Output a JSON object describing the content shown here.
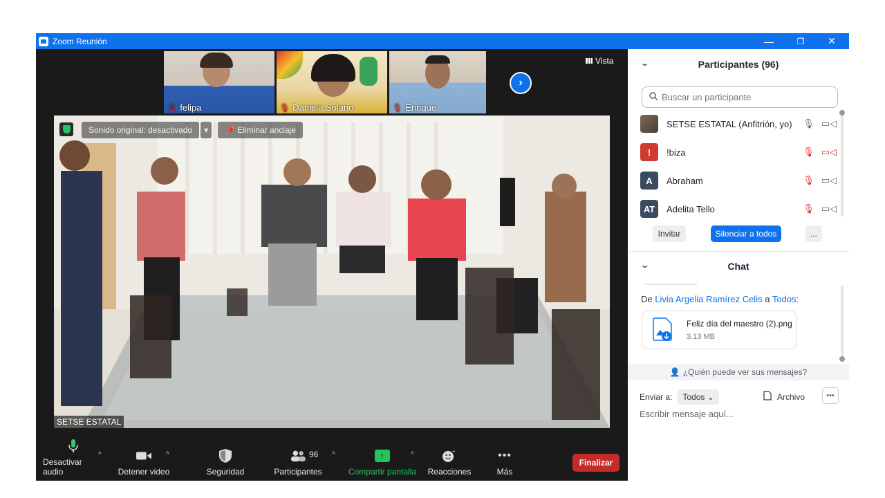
{
  "window": {
    "title": "Zoom Reunión",
    "controls": [
      "—",
      "❐",
      "✕"
    ]
  },
  "thumbnails": [
    {
      "name": "felipa",
      "mic": "muted"
    },
    {
      "name": "Daniela Solano",
      "mic": "muted"
    },
    {
      "name": "Enrique",
      "mic": "muted"
    }
  ],
  "view_button": "Vista",
  "main_video": {
    "sound_label": "Sonido original: desactivado",
    "unpin_label": "Eliminar anclaje",
    "speaker_name": "SETSE ESTATAL"
  },
  "toolbar": {
    "audio": "Desactivar audio",
    "video": "Detener video",
    "security": "Seguridad",
    "participants": "Participantes",
    "participants_count": "96",
    "share": "Compartir pantalla",
    "reactions": "Reacciones",
    "more": "Más",
    "end": "Finalizar"
  },
  "participants_panel": {
    "title": "Participantes (96)",
    "search_placeholder": "Buscar un participante",
    "rows": [
      {
        "name": "SETSE ESTATAL (Anfitrión, yo)",
        "avatar": "",
        "color": "#6b5a48"
      },
      {
        "name": "!biza",
        "avatar": "!",
        "color": "#d03a2f"
      },
      {
        "name": "Abraham",
        "avatar": "A",
        "color": "#3b4a5e"
      },
      {
        "name": "Adelita Tello",
        "avatar": "AT",
        "color": "#3b4a5e"
      }
    ],
    "invite": "Invitar",
    "mute_all": "Silenciar a todos",
    "more": "..."
  },
  "chat_panel": {
    "title": "Chat",
    "from_prefix": "De",
    "from_name": "Livia Argelia Ramírez Celis",
    "to_word": "a",
    "to_name": "Todos:",
    "file_name": "Feliz día del maestro (2).png",
    "file_size": "3.13 MB",
    "who_sees": "¿Quién puede ver sus mensajes?",
    "send_to_label": "Enviar a:",
    "send_to_value": "Todos",
    "file_button": "Archivo",
    "input_placeholder": "Escribir mensaje aquí..."
  },
  "colors": {
    "zoom_blue": "#0e72ed",
    "end_red": "#c42c2c",
    "share_green": "#23c45e",
    "muted_red": "#e02828"
  }
}
